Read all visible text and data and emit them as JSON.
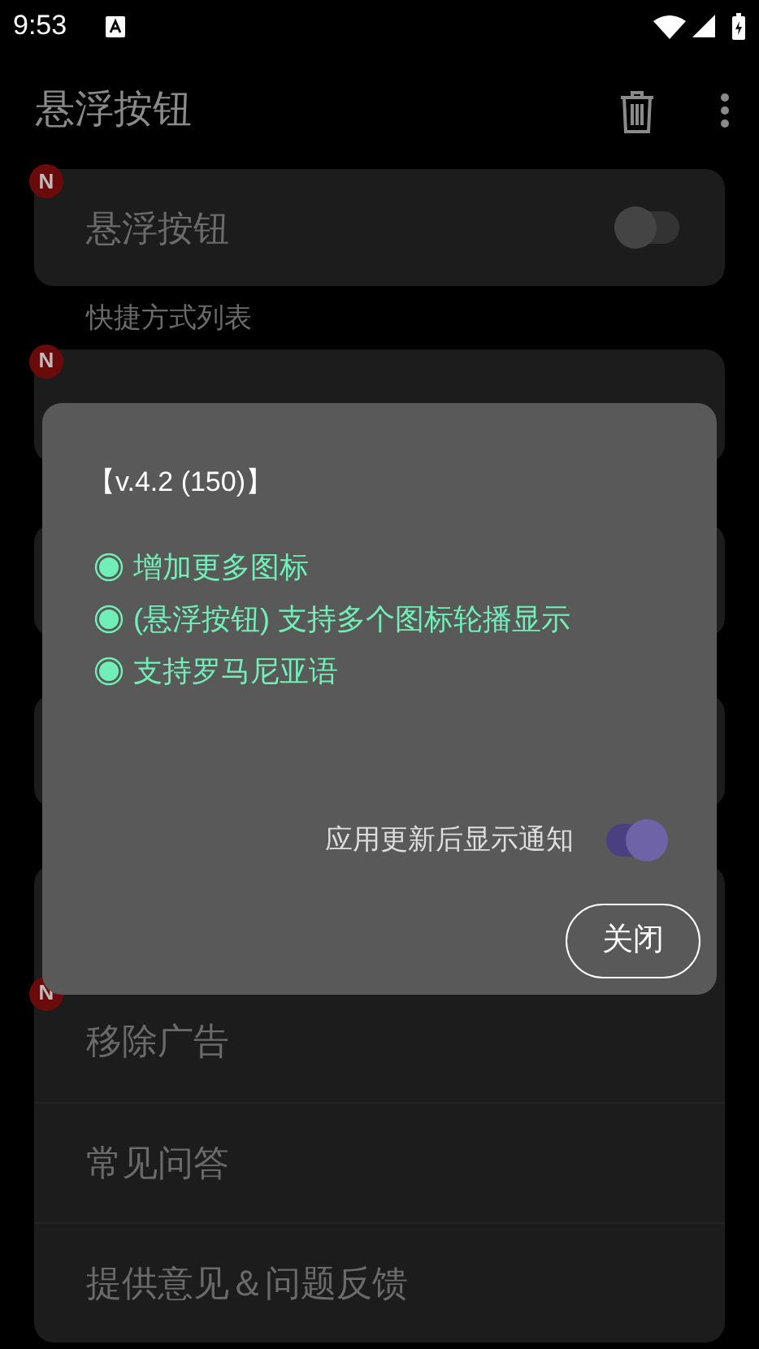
{
  "status_bar": {
    "time": "9:53"
  },
  "app_bar": {
    "title": "悬浮按钮"
  },
  "floating_card": {
    "badge": "N",
    "label": "悬浮按钮",
    "switch": {
      "on": false
    }
  },
  "section_label": "快捷方式列表",
  "custom_list_card": {
    "badge": "N"
  },
  "menu_items": [
    {
      "label": "移除广告",
      "badge": "N"
    },
    {
      "label": "常见问答"
    },
    {
      "label": "提供意见＆问题反馈"
    }
  ],
  "dialog": {
    "version": "【v.4.2 (150)】",
    "changes": [
      {
        "text": "增加更多图标"
      },
      {
        "text": "(悬浮按钮) 支持多个图标轮播显示"
      },
      {
        "text": "支持罗马尼亚语"
      }
    ],
    "notify_toggle": {
      "label": "应用更新后显示通知",
      "on": true
    },
    "close_button": "关闭"
  }
}
